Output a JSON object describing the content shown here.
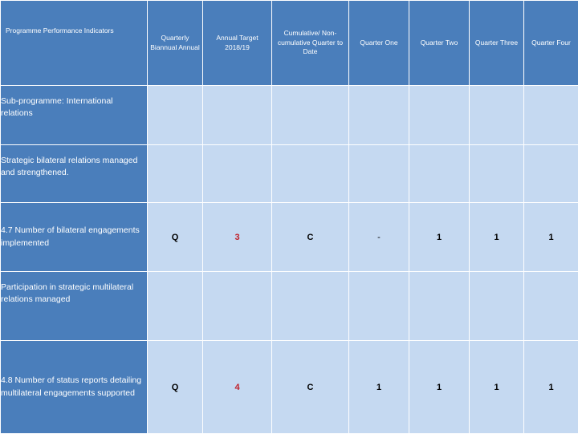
{
  "table": {
    "headers": [
      "Programme Performance Indicators",
      "Quarterly Biannual Annual",
      "Annual Target 2018/19",
      "Cumulative/ Non-cumulative Quarter to Date",
      "Quarter One",
      "Quarter Two",
      "Quarter Three",
      "Quarter Four"
    ],
    "rows": [
      {
        "label": "Sub-programme: International relations",
        "cells": [
          "",
          "",
          "",
          "",
          "",
          "",
          ""
        ]
      },
      {
        "label": "Strategic bilateral relations managed and strengthened.",
        "cells": [
          "",
          "",
          "",
          "",
          "",
          "",
          ""
        ]
      },
      {
        "label": "4.7 Number of bilateral engagements implemented",
        "cells": [
          "Q",
          "3",
          "C",
          "-",
          "1",
          "1",
          "1"
        ]
      },
      {
        "label": "Participation in strategic multilateral relations managed",
        "cells": [
          "",
          "",
          "",
          "",
          "",
          "",
          ""
        ]
      },
      {
        "label": "4.8 Number of status reports detailing multilateral engagements supported",
        "cells": [
          "Q",
          "4",
          "C",
          "1",
          "1",
          "1",
          "1"
        ]
      }
    ]
  },
  "colors": {
    "header_bg": "#4a7ebb",
    "data_bg": "#c5d9f1",
    "target_text": "#c0202a",
    "header_text": "#ffffff"
  }
}
